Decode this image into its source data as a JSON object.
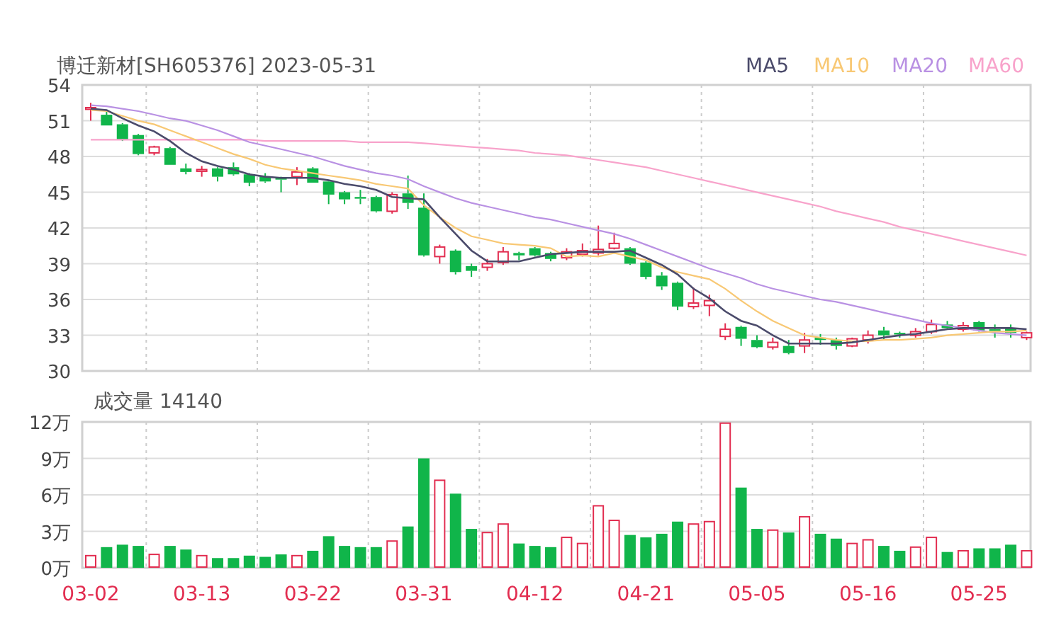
{
  "price_panel": {
    "chart_data": {
      "type": "candlestick",
      "title": "博迁新材[SH605376] 2023-05-31",
      "grid": true,
      "ylim": [
        30,
        54
      ],
      "yticks": [
        30,
        33,
        36,
        39,
        42,
        45,
        48,
        51,
        54
      ],
      "ohlc": [
        [
          52.0,
          52.5,
          51.0,
          52.1
        ],
        [
          51.5,
          51.9,
          50.6,
          50.6
        ],
        [
          50.7,
          50.8,
          49.3,
          49.4
        ],
        [
          49.8,
          49.9,
          48.1,
          48.2
        ],
        [
          48.3,
          48.9,
          48.1,
          48.8
        ],
        [
          48.7,
          48.8,
          47.3,
          47.3
        ],
        [
          47.0,
          47.4,
          46.5,
          46.7
        ],
        [
          46.8,
          47.2,
          46.3,
          46.9
        ],
        [
          47.0,
          47.1,
          45.9,
          46.3
        ],
        [
          47.1,
          47.5,
          46.4,
          46.5
        ],
        [
          46.5,
          46.6,
          45.5,
          45.8
        ],
        [
          46.3,
          46.6,
          45.8,
          45.9
        ],
        [
          46.2,
          46.3,
          45.0,
          46.1
        ],
        [
          46.3,
          47.1,
          45.6,
          46.7
        ],
        [
          47.0,
          47.1,
          45.8,
          45.8
        ],
        [
          45.9,
          46.0,
          44.0,
          44.8
        ],
        [
          45.0,
          45.1,
          44.0,
          44.4
        ],
        [
          44.6,
          45.2,
          44.0,
          44.5
        ],
        [
          44.6,
          44.7,
          43.3,
          43.4
        ],
        [
          43.4,
          45.0,
          43.2,
          44.8
        ],
        [
          44.9,
          46.4,
          43.6,
          44.1
        ],
        [
          43.7,
          44.9,
          39.6,
          39.7
        ],
        [
          39.6,
          40.6,
          39.0,
          40.4
        ],
        [
          40.1,
          40.2,
          38.1,
          38.3
        ],
        [
          38.8,
          39.0,
          37.9,
          38.4
        ],
        [
          38.7,
          39.4,
          38.4,
          39.0
        ],
        [
          39.1,
          40.4,
          38.9,
          40.0
        ],
        [
          39.9,
          40.0,
          39.3,
          39.7
        ],
        [
          40.3,
          40.4,
          39.6,
          39.7
        ],
        [
          39.9,
          40.0,
          39.2,
          39.4
        ],
        [
          39.5,
          40.3,
          39.3,
          40.0
        ],
        [
          39.8,
          40.7,
          39.6,
          40.1
        ],
        [
          39.9,
          42.2,
          39.7,
          40.2
        ],
        [
          40.3,
          41.6,
          40.2,
          40.7
        ],
        [
          40.3,
          40.4,
          38.9,
          39.0
        ],
        [
          39.1,
          39.2,
          37.7,
          37.9
        ],
        [
          38.0,
          38.3,
          36.8,
          37.1
        ],
        [
          37.4,
          37.5,
          35.1,
          35.4
        ],
        [
          35.4,
          37.0,
          35.2,
          35.7
        ],
        [
          35.5,
          36.4,
          34.6,
          35.9
        ],
        [
          32.9,
          34.0,
          32.6,
          33.5
        ],
        [
          33.7,
          33.8,
          32.1,
          32.7
        ],
        [
          32.6,
          33.0,
          31.9,
          32.0
        ],
        [
          32.0,
          32.8,
          31.8,
          32.4
        ],
        [
          32.1,
          32.6,
          31.4,
          31.5
        ],
        [
          32.1,
          33.2,
          31.5,
          32.6
        ],
        [
          32.8,
          33.1,
          32.2,
          32.6
        ],
        [
          32.6,
          32.8,
          31.8,
          32.1
        ],
        [
          32.1,
          32.8,
          32.0,
          32.7
        ],
        [
          32.6,
          33.4,
          32.3,
          33.0
        ],
        [
          33.4,
          33.7,
          32.6,
          33.0
        ],
        [
          33.2,
          33.3,
          32.8,
          33.1
        ],
        [
          33.0,
          33.6,
          32.8,
          33.3
        ],
        [
          33.3,
          34.3,
          33.1,
          33.9
        ],
        [
          33.9,
          34.2,
          33.5,
          33.6
        ],
        [
          33.5,
          34.1,
          33.3,
          33.8
        ],
        [
          34.1,
          34.2,
          33.3,
          33.4
        ],
        [
          33.5,
          33.9,
          32.8,
          33.4
        ],
        [
          33.6,
          33.9,
          32.8,
          33.2
        ],
        [
          32.8,
          33.3,
          32.6,
          33.2
        ]
      ],
      "series": [
        {
          "name": "MA5",
          "type": "line",
          "color": "#4b4b6b",
          "values": [
            52.0,
            51.9,
            51.2,
            50.6,
            50.1,
            49.3,
            48.3,
            47.6,
            47.2,
            46.9,
            46.5,
            46.3,
            46.2,
            46.2,
            46.2,
            46.0,
            45.7,
            45.5,
            45.2,
            44.6,
            44.5,
            44.4,
            42.9,
            41.5,
            40.1,
            39.2,
            39.2,
            39.2,
            39.5,
            39.8,
            39.9,
            40.0,
            40.0,
            40.0,
            40.1,
            39.5,
            38.9,
            38.1,
            36.9,
            36.1,
            35.0,
            34.2,
            33.8,
            33.0,
            32.3,
            32.3,
            32.3,
            32.3,
            32.4,
            32.6,
            32.8,
            33.0,
            33.1,
            33.3,
            33.5,
            33.6,
            33.6,
            33.6,
            33.6,
            33.5
          ]
        },
        {
          "name": "MA10",
          "type": "line",
          "color": "#f8c874",
          "values": [
            51.9,
            51.8,
            51.4,
            51.0,
            50.7,
            50.2,
            49.7,
            49.2,
            48.7,
            48.2,
            47.8,
            47.3,
            47.0,
            46.8,
            46.6,
            46.4,
            46.2,
            46.0,
            45.7,
            45.5,
            45.3,
            43.9,
            42.9,
            42.0,
            41.3,
            41.0,
            40.7,
            40.6,
            40.5,
            40.3,
            39.6,
            39.7,
            39.6,
            39.9,
            39.6,
            39.3,
            38.7,
            38.3,
            38.0,
            37.7,
            36.9,
            35.9,
            35.0,
            34.2,
            33.6,
            33.0,
            32.8,
            32.6,
            32.5,
            32.5,
            32.6,
            32.6,
            32.7,
            32.8,
            33.0,
            33.1,
            33.2,
            33.3,
            33.3,
            33.4
          ]
        },
        {
          "name": "MA20",
          "type": "line",
          "color": "#b991e3",
          "values": [
            52.3,
            52.2,
            52.0,
            51.8,
            51.5,
            51.2,
            51.0,
            50.6,
            50.2,
            49.7,
            49.2,
            48.9,
            48.6,
            48.3,
            48.0,
            47.6,
            47.2,
            46.9,
            46.6,
            46.4,
            46.1,
            45.5,
            45.0,
            44.5,
            44.1,
            43.8,
            43.5,
            43.2,
            42.9,
            42.7,
            42.4,
            42.1,
            41.8,
            41.5,
            41.1,
            40.6,
            40.1,
            39.6,
            39.1,
            38.6,
            38.2,
            37.8,
            37.3,
            36.9,
            36.6,
            36.3,
            36.0,
            35.8,
            35.5,
            35.2,
            34.9,
            34.6,
            34.3,
            34.0,
            33.8,
            33.6,
            33.4,
            33.2,
            33.1,
            33.0
          ]
        },
        {
          "name": "MA60",
          "type": "line",
          "color": "#f8a3cb",
          "values": [
            49.4,
            49.4,
            49.4,
            49.4,
            49.4,
            49.4,
            49.4,
            49.4,
            49.4,
            49.4,
            49.4,
            49.3,
            49.3,
            49.3,
            49.3,
            49.3,
            49.3,
            49.2,
            49.2,
            49.2,
            49.2,
            49.1,
            49.0,
            48.9,
            48.8,
            48.7,
            48.6,
            48.5,
            48.3,
            48.2,
            48.1,
            47.9,
            47.7,
            47.5,
            47.3,
            47.1,
            46.8,
            46.5,
            46.2,
            45.9,
            45.6,
            45.3,
            45.0,
            44.7,
            44.4,
            44.1,
            43.8,
            43.4,
            43.1,
            42.8,
            42.5,
            42.1,
            41.8,
            41.5,
            41.2,
            40.9,
            40.6,
            40.3,
            40.0,
            39.7
          ]
        }
      ]
    }
  },
  "volume_panel": {
    "chart_data": {
      "type": "bar",
      "title": "成交量 14140",
      "grid": true,
      "ylim": [
        0,
        12
      ],
      "categories": [
        "03-02",
        null,
        null,
        null,
        null,
        null,
        null,
        "03-13",
        null,
        null,
        null,
        null,
        null,
        null,
        "03-22",
        null,
        null,
        null,
        null,
        null,
        null,
        "03-31",
        null,
        null,
        null,
        null,
        null,
        null,
        "04-12",
        null,
        null,
        null,
        null,
        null,
        null,
        "04-21",
        null,
        null,
        null,
        null,
        null,
        null,
        "05-05",
        null,
        null,
        null,
        null,
        null,
        null,
        "05-16",
        null,
        null,
        null,
        null,
        null,
        null,
        "05-25",
        null,
        null,
        null
      ],
      "yticks": [
        {
          "value": 0,
          "label": "0万"
        },
        {
          "value": 3,
          "label": "3万"
        },
        {
          "value": 6,
          "label": "6万"
        },
        {
          "value": 9,
          "label": "9万"
        },
        {
          "value": 12,
          "label": "12万"
        }
      ],
      "values": [
        1.0,
        1.7,
        1.9,
        1.8,
        1.1,
        1.8,
        1.5,
        1.0,
        0.8,
        0.8,
        1.0,
        0.9,
        1.1,
        1.0,
        1.4,
        2.6,
        1.8,
        1.7,
        1.7,
        2.2,
        3.4,
        9.0,
        7.2,
        6.1,
        3.2,
        2.9,
        3.6,
        2.0,
        1.8,
        1.7,
        2.5,
        2.0,
        5.1,
        3.9,
        2.7,
        2.5,
        2.8,
        3.8,
        3.6,
        3.8,
        11.9,
        6.6,
        3.2,
        3.1,
        2.9,
        4.2,
        2.8,
        2.4,
        2.0,
        2.3,
        1.8,
        1.4,
        1.7,
        2.5,
        1.3,
        1.4,
        1.6,
        1.6,
        1.9,
        1.4
      ]
    }
  }
}
